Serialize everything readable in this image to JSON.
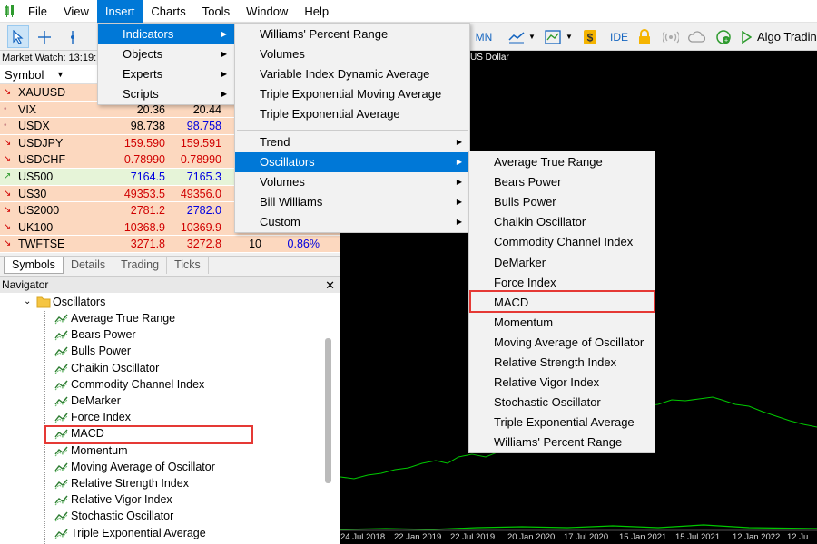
{
  "menubar": {
    "items": [
      "File",
      "View",
      "Insert",
      "Charts",
      "Tools",
      "Window",
      "Help"
    ],
    "active": "Insert"
  },
  "toolbar": {
    "timeframe_mn": "MN",
    "ide_label": "IDE",
    "algo_label": "Algo Tradin",
    "icons": [
      "cursor-icon",
      "crosshair-icon",
      "vertical-line-icon",
      "line-chart-icon",
      "chart-template-icon",
      "dollar-icon",
      "lock-icon",
      "signal-icon",
      "cloud-icon",
      "globe-icon",
      "play-icon"
    ]
  },
  "market_watch": {
    "title": "Market Watch: 13:19:1",
    "header_symbol": "Symbol",
    "rows": [
      {
        "symbol": "XAUUSD",
        "dir": "down",
        "bid": "",
        "ask": "",
        "spread": "",
        "change": "",
        "bid_color": "blk",
        "ask_color": "blk"
      },
      {
        "symbol": "VIX",
        "dir": "dot",
        "bid": "20.36",
        "ask": "20.44",
        "spread": "",
        "change": "",
        "bid_color": "blk",
        "ask_color": "blk"
      },
      {
        "symbol": "USDX",
        "dir": "dot",
        "bid": "98.738",
        "ask": "98.758",
        "spread": "",
        "change": "",
        "bid_color": "blk",
        "ask_color": "blue"
      },
      {
        "symbol": "USDJPY",
        "dir": "down",
        "bid": "159.590",
        "ask": "159.591",
        "spread": "",
        "change": "",
        "bid_color": "red",
        "ask_color": "red"
      },
      {
        "symbol": "USDCHF",
        "dir": "down",
        "bid": "0.78990",
        "ask": "0.78990",
        "spread": "",
        "change": "",
        "bid_color": "red",
        "ask_color": "red"
      },
      {
        "symbol": "US500",
        "dir": "up",
        "bid": "7164.5",
        "ask": "7165.3",
        "spread": "",
        "change": "",
        "bid_color": "blue",
        "ask_color": "blue"
      },
      {
        "symbol": "US30",
        "dir": "down",
        "bid": "49353.5",
        "ask": "49356.0",
        "spread": "",
        "change": "",
        "bid_color": "red",
        "ask_color": "red"
      },
      {
        "symbol": "US2000",
        "dir": "down",
        "bid": "2781.2",
        "ask": "2782.0",
        "spread": "",
        "change": "",
        "bid_color": "red",
        "ask_color": "blue"
      },
      {
        "symbol": "UK100",
        "dir": "down",
        "bid": "10368.9",
        "ask": "10369.9",
        "spread": "",
        "change": "",
        "bid_color": "red",
        "ask_color": "red"
      },
      {
        "symbol": "TWFTSE",
        "dir": "down",
        "bid": "3271.8",
        "ask": "3272.8",
        "spread": "10",
        "change": "0.86%",
        "bid_color": "red",
        "ask_color": "red"
      }
    ],
    "tabs": [
      "Symbols",
      "Details",
      "Trading",
      "Ticks"
    ],
    "active_tab": "Symbols"
  },
  "navigator": {
    "title": "Navigator",
    "folder": "Oscillators",
    "items": [
      "Average True Range",
      "Bears Power",
      "Bulls Power",
      "Chaikin Oscillator",
      "Commodity Channel Index",
      "DeMarker",
      "Force Index",
      "MACD",
      "Momentum",
      "Moving Average of Oscillator",
      "Relative Strength Index",
      "Relative Vigor Index",
      "Stochastic Oscillator",
      "Triple Exponential Average"
    ],
    "highlighted": "MACD"
  },
  "chart": {
    "title_fragment": "US Dollar",
    "x_labels": [
      "24 Jul 2018",
      "22 Jan 2019",
      "22 Jul 2019",
      "20 Jan 2020",
      "17 Jul 2020",
      "15 Jan 2021",
      "15 Jul 2021",
      "12 Jan 2022",
      "12 Ju"
    ]
  },
  "insert_menu": {
    "items": [
      {
        "label": "Indicators",
        "submenu": true,
        "highlighted": true
      },
      {
        "label": "Objects",
        "submenu": true
      },
      {
        "label": "Experts",
        "submenu": true
      },
      {
        "label": "Scripts",
        "submenu": true
      }
    ]
  },
  "indicators_menu": {
    "top_items": [
      "Williams' Percent Range",
      "Volumes",
      "Variable Index Dynamic Average",
      "Triple Exponential Moving Average",
      "Triple Exponential Average"
    ],
    "group_items": [
      {
        "label": "Trend",
        "highlighted": false
      },
      {
        "label": "Oscillators",
        "highlighted": true
      },
      {
        "label": "Volumes",
        "highlighted": false
      },
      {
        "label": "Bill Williams",
        "highlighted": false
      },
      {
        "label": "Custom",
        "highlighted": false
      }
    ]
  },
  "oscillators_menu": {
    "items": [
      "Average True Range",
      "Bears Power",
      "Bulls Power",
      "Chaikin Oscillator",
      "Commodity Channel Index",
      "DeMarker",
      "Force Index",
      "MACD",
      "Momentum",
      "Moving Average of Oscillator",
      "Relative Strength Index",
      "Relative Vigor Index",
      "Stochastic Oscillator",
      "Triple Exponential Average",
      "Williams' Percent Range"
    ],
    "boxed": "MACD"
  },
  "colors": {
    "menu_highlight": "#0078d7",
    "annotation_box": "#e53935",
    "chart_line": "#00c800"
  }
}
